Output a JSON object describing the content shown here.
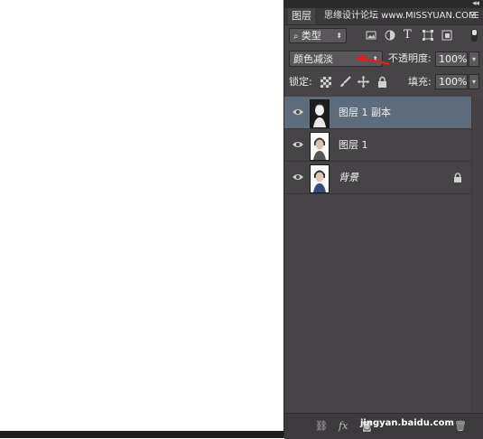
{
  "panel": {
    "tab_label": "图层",
    "watermark": "思缘设计论坛 www.MISSYUAN.COM",
    "filter": {
      "label": "类型",
      "icons": [
        "image-filter-icon",
        "adjustment-filter-icon",
        "text-filter-icon",
        "shape-filter-icon",
        "smart-object-filter-icon"
      ]
    },
    "blend_mode": "颜色减淡",
    "opacity": {
      "label": "不透明度:",
      "value": "100%"
    },
    "lock": {
      "label": "锁定:",
      "icons": [
        "lock-transparency-icon",
        "lock-pixels-icon",
        "lock-position-icon",
        "lock-all-icon"
      ]
    },
    "fill": {
      "label": "填充:",
      "value": "100%"
    },
    "layers": [
      {
        "name": "图层 1 副本",
        "selected": true,
        "locked": false
      },
      {
        "name": "图层 1",
        "selected": false,
        "locked": false
      },
      {
        "name": "背景",
        "selected": false,
        "locked": true
      }
    ],
    "bottom_bar": {
      "fx": "fx",
      "watermark": "jingyan.baidu.com"
    }
  },
  "colors": {
    "panel_bg": "#474447",
    "selected_layer": "#5e6b7a",
    "arrow": "#e02020"
  }
}
